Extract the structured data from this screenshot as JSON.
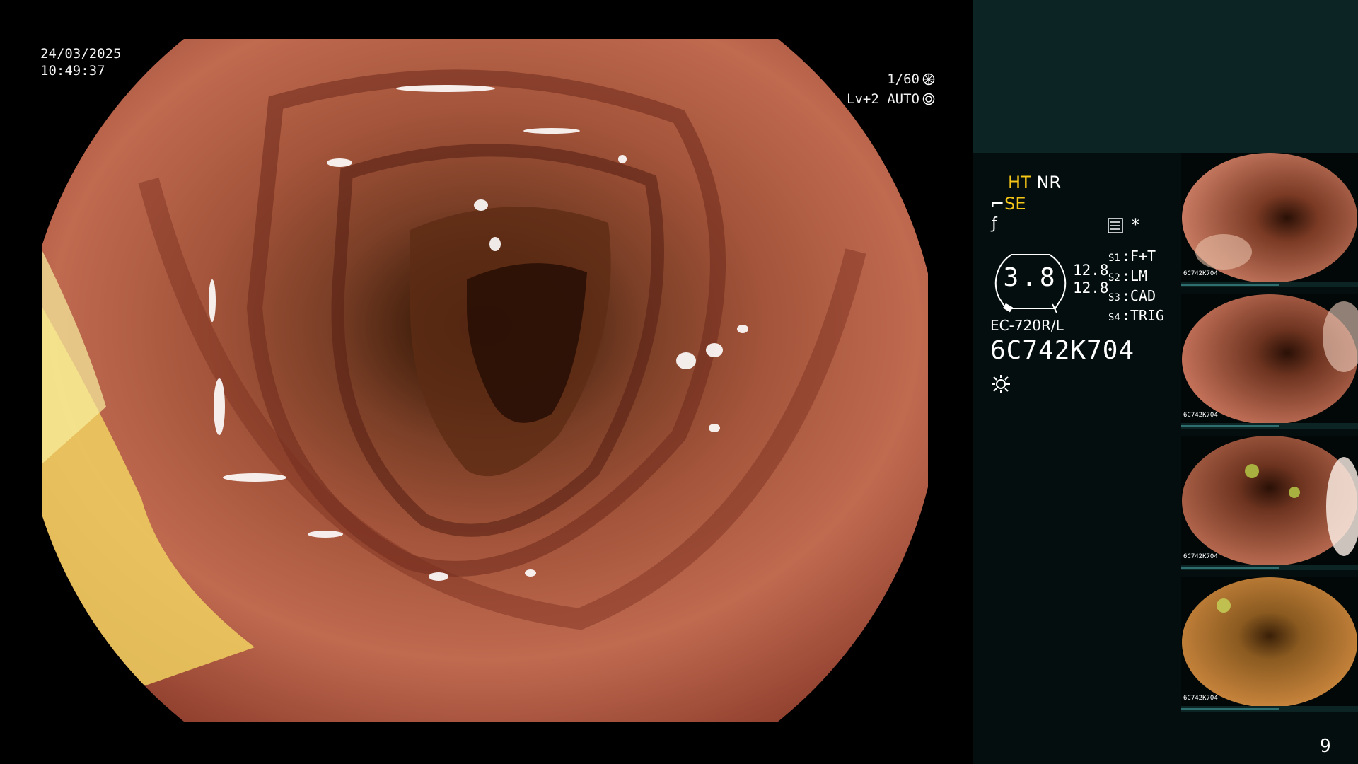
{
  "overlay": {
    "date": "24/03/2025",
    "time": "10:49:37",
    "shutter": "1/60",
    "level": "Lv+2 AUTO"
  },
  "panel": {
    "mode_ht": "HT",
    "mode_nr": "NR",
    "mode_se": "SE",
    "gauge_value": "3.8",
    "value_1": "12.8",
    "value_2": "12.8",
    "slots": [
      {
        "key": "S1",
        "value": "F+T"
      },
      {
        "key": "S2",
        "value": "LM"
      },
      {
        "key": "S3",
        "value": "CAD"
      },
      {
        "key": "S4",
        "value": "TRIG"
      }
    ],
    "scope_model": "EC-720R/L",
    "serial": "6C742K704",
    "asterisk": "*"
  },
  "thumbnails": [
    {
      "label": "6C742K704"
    },
    {
      "label": "6C742K704"
    },
    {
      "label": "6C742K704"
    },
    {
      "label": "6C742K704"
    }
  ],
  "page_number": "9",
  "colors": {
    "mode_accent": "#f5c518",
    "panel_bg": "#040e0e",
    "panel_top_bg": "#0d2424",
    "mucosa": "#b45a44"
  }
}
